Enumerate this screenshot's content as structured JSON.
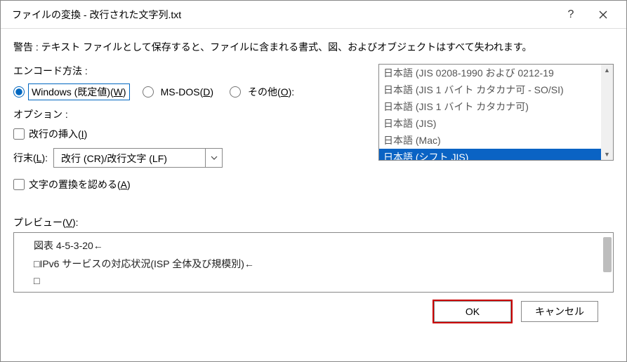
{
  "title": "ファイルの変換 - 改行された文字列.txt",
  "warning": "警告 : テキスト ファイルとして保存すると、ファイルに含まれる書式、図、およびオブジェクトはすべて失われます。",
  "encoding_label": "エンコード方法 :",
  "radios": {
    "windows": "Windows (既定値)(W)",
    "msdos": "MS-DOS(D)",
    "other": "その他(O):"
  },
  "encoding_list": [
    "日本語 (JIS 0208-1990 および 0212-19",
    "日本語 (JIS 1 バイト カタカナ可 - SO/SI)",
    "日本語 (JIS 1 バイト カタカナ可)",
    "日本語 (JIS)",
    "日本語 (Mac)",
    "日本語 (シフト JIS)"
  ],
  "encoding_selected_index": 5,
  "options_label": "オプション :",
  "insert_linebreak": "改行の挿入(I)",
  "line_end_label": "行末(L):",
  "line_end_value": "改行 (CR)/改行文字 (LF)",
  "allow_subst": "文字の置換を認める(A)",
  "preview_label": "プレビュー(V):",
  "preview_lines": [
    "図表 4-5-3-20←",
    "□IPv6 サービスの対応状況(ISP 全体及び規模別)←",
    "□"
  ],
  "ok": "OK",
  "cancel": "キャンセル"
}
